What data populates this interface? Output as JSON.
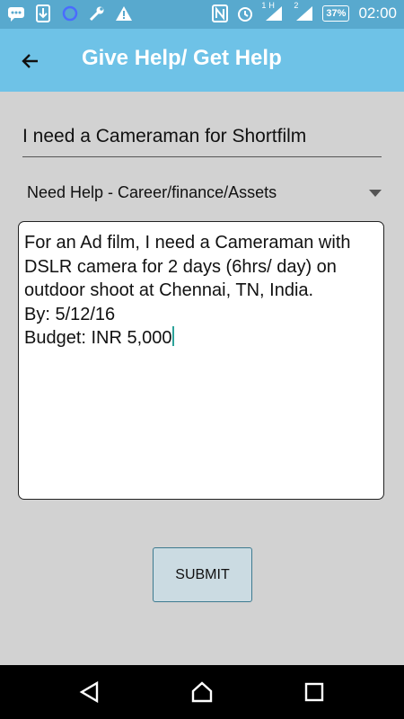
{
  "status_bar": {
    "battery": "37%",
    "time": "02:00",
    "sim1_label": "1",
    "sim2_label": "2",
    "network_label": "H",
    "icons": [
      "chat-icon",
      "download-icon",
      "sync-icon",
      "wrench-icon",
      "warning-icon",
      "nfc-icon",
      "alarm-icon",
      "signal-icon",
      "battery-icon"
    ]
  },
  "app_bar": {
    "title": "Give Help/ Get Help"
  },
  "form": {
    "title_value": "I need a Cameraman for Shortfilm",
    "category_selected": "Need Help - Career/finance/Assets",
    "description": "For an Ad film, I need a Cameraman with DSLR camera for 2 days (6hrs/ day) on outdoor shoot at Chennai, TN, India.\nBy: 5/12/16\nBudget: INR 5,000",
    "submit_label": "SUBMIT"
  },
  "colors": {
    "status_bar": "#58a9ce",
    "app_bar": "#6ec2e7",
    "background": "#d2d2d2",
    "submit_bg": "#cbdbe2",
    "cursor": "#2ea39a"
  }
}
